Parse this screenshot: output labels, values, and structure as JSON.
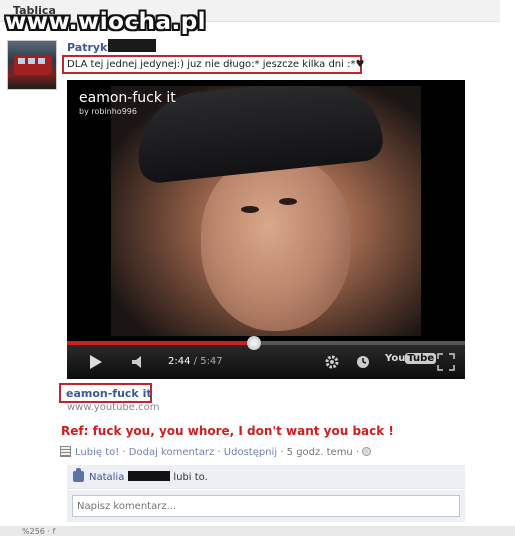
{
  "page": {
    "section_title": "Tablica"
  },
  "watermark": "www.wiocha.pl",
  "post": {
    "author": "Patryk",
    "status_text": "DLA tej jednej jedynej:) juz nie długo:* jeszcze kilka dni :*♥"
  },
  "video": {
    "title": "eamon-fuck it",
    "uploader": "by robinho996",
    "current_time": "2:44",
    "total_time": "5:47",
    "progress": 0.47,
    "logo_you": "You",
    "logo_tube": "Tube"
  },
  "link": {
    "title": "eamon-fuck it",
    "domain": "www.youtube.com"
  },
  "caption": "Ref: fuck you, you whore, I don't want you back !",
  "actions": {
    "like": "Lubię to!",
    "separator": " · ",
    "comment": "Dodaj komentarz",
    "share": "Udostępnij",
    "time": "5 godz. temu",
    "trailing_sep": " · "
  },
  "likes": {
    "name": "Natalia",
    "suffix": "lubi to."
  },
  "comment": {
    "placeholder": "Napisz komentarz..."
  },
  "footer": {
    "text": "%256 · f"
  },
  "colors": {
    "link_blue": "#3b5998",
    "highlight_red": "#c0262c",
    "caption_red": "#d11d1d"
  }
}
